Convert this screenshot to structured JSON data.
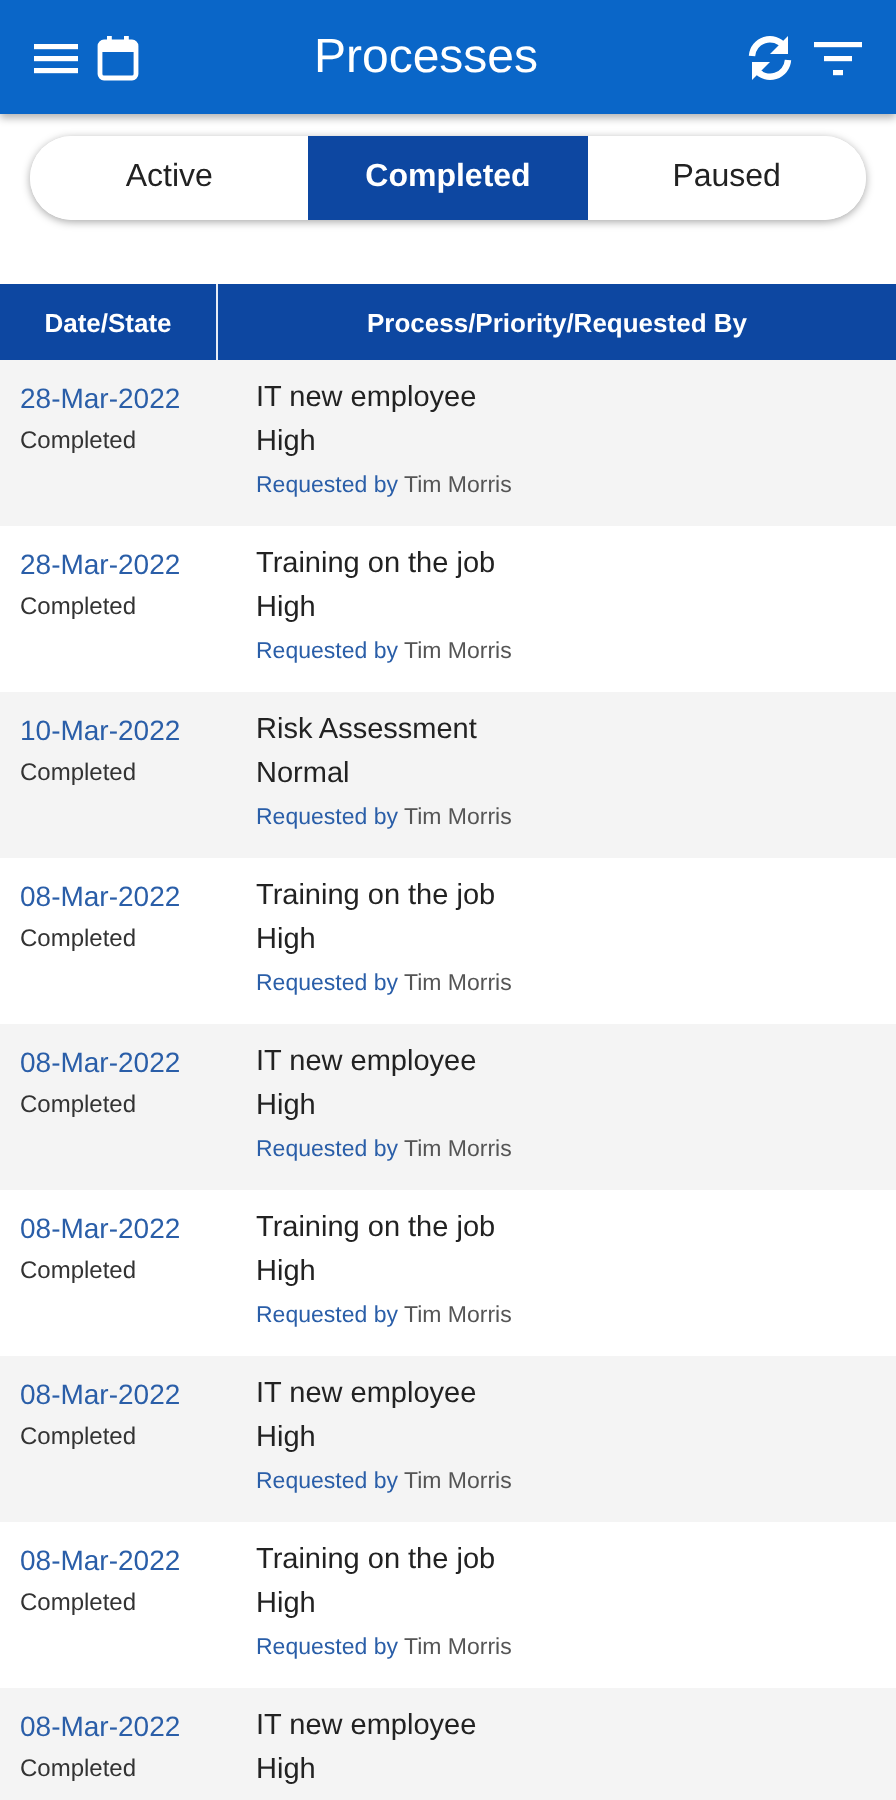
{
  "app_bar": {
    "title": "Processes"
  },
  "tabs": [
    {
      "label": "Active",
      "selected": false
    },
    {
      "label": "Completed",
      "selected": true
    },
    {
      "label": "Paused",
      "selected": false
    }
  ],
  "table": {
    "columns": [
      "Date/State",
      "Process/Priority/Requested By"
    ],
    "rows": [
      {
        "date": "28-Mar-2022",
        "state": "Completed",
        "process": "IT new employee",
        "priority": "High",
        "requested_label": "Requested by",
        "requested_by": "Tim Morris"
      },
      {
        "date": "28-Mar-2022",
        "state": "Completed",
        "process": "Training on the job",
        "priority": "High",
        "requested_label": "Requested by",
        "requested_by": "Tim Morris"
      },
      {
        "date": "10-Mar-2022",
        "state": "Completed",
        "process": "Risk Assessment",
        "priority": "Normal",
        "requested_label": "Requested by",
        "requested_by": "Tim Morris"
      },
      {
        "date": "08-Mar-2022",
        "state": "Completed",
        "process": "Training on the job",
        "priority": "High",
        "requested_label": "Requested by",
        "requested_by": "Tim Morris"
      },
      {
        "date": "08-Mar-2022",
        "state": "Completed",
        "process": "IT new employee",
        "priority": "High",
        "requested_label": "Requested by",
        "requested_by": "Tim Morris"
      },
      {
        "date": "08-Mar-2022",
        "state": "Completed",
        "process": "Training on the job",
        "priority": "High",
        "requested_label": "Requested by",
        "requested_by": "Tim Morris"
      },
      {
        "date": "08-Mar-2022",
        "state": "Completed",
        "process": "IT new employee",
        "priority": "High",
        "requested_label": "Requested by",
        "requested_by": "Tim Morris"
      },
      {
        "date": "08-Mar-2022",
        "state": "Completed",
        "process": "Training on the job",
        "priority": "High",
        "requested_label": "Requested by",
        "requested_by": "Tim Morris"
      },
      {
        "date": "08-Mar-2022",
        "state": "Completed",
        "process": "IT new employee",
        "priority": "High"
      }
    ]
  }
}
